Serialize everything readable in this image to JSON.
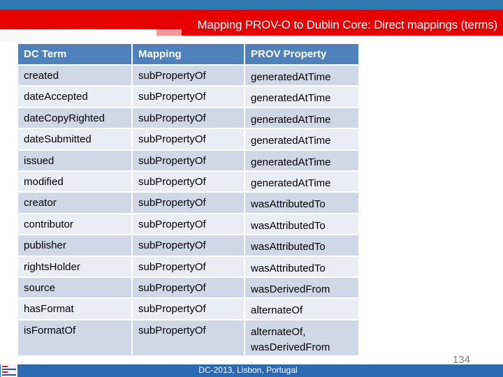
{
  "slide": {
    "title": "Mapping PROV-O to Dublin Core: Direct mappings (terms)",
    "footer": "DC-2013, Lisbon, Portugal",
    "page_number": "134",
    "logo_icon": "dcmi-logo-icon",
    "colors": {
      "top_band": "#2f7bb1",
      "title_band": "#e60000",
      "table_header": "#4f81bd",
      "row_odd": "#d0d8e8",
      "row_even": "#e9edf4",
      "footer_band": "#2a6ab5"
    }
  },
  "table": {
    "headers": [
      "DC Term",
      "Mapping",
      "PROV Property"
    ],
    "rows": [
      {
        "dc_term": "created",
        "mapping": "subPropertyOf",
        "prov": [
          "generatedAtTime"
        ]
      },
      {
        "dc_term": "dateAccepted",
        "mapping": "subPropertyOf",
        "prov": [
          "generatedAtTime"
        ]
      },
      {
        "dc_term": "dateCopyRighted",
        "mapping": "subPropertyOf",
        "prov": [
          "generatedAtTime"
        ]
      },
      {
        "dc_term": "dateSubmitted",
        "mapping": "subPropertyOf",
        "prov": [
          "generatedAtTime"
        ]
      },
      {
        "dc_term": "issued",
        "mapping": "subPropertyOf",
        "prov": [
          "generatedAtTime"
        ]
      },
      {
        "dc_term": "modified",
        "mapping": "subPropertyOf",
        "prov": [
          "generatedAtTime"
        ]
      },
      {
        "dc_term": "creator",
        "mapping": "subPropertyOf",
        "prov": [
          "wasAttributedTo"
        ]
      },
      {
        "dc_term": "contributor",
        "mapping": "subPropertyOf",
        "prov": [
          "wasAttributedTo"
        ]
      },
      {
        "dc_term": "publisher",
        "mapping": "subPropertyOf",
        "prov": [
          "wasAttributedTo"
        ]
      },
      {
        "dc_term": "rightsHolder",
        "mapping": "subPropertyOf",
        "prov": [
          "wasAttributedTo"
        ]
      },
      {
        "dc_term": "source",
        "mapping": "subPropertyOf",
        "prov": [
          "wasDerivedFrom"
        ]
      },
      {
        "dc_term": "hasFormat",
        "mapping": "subPropertyOf",
        "prov": [
          "alternateOf"
        ]
      },
      {
        "dc_term": "isFormatOf",
        "mapping": "subPropertyOf",
        "prov": [
          "alternateOf,",
          "wasDerivedFrom"
        ]
      }
    ]
  }
}
